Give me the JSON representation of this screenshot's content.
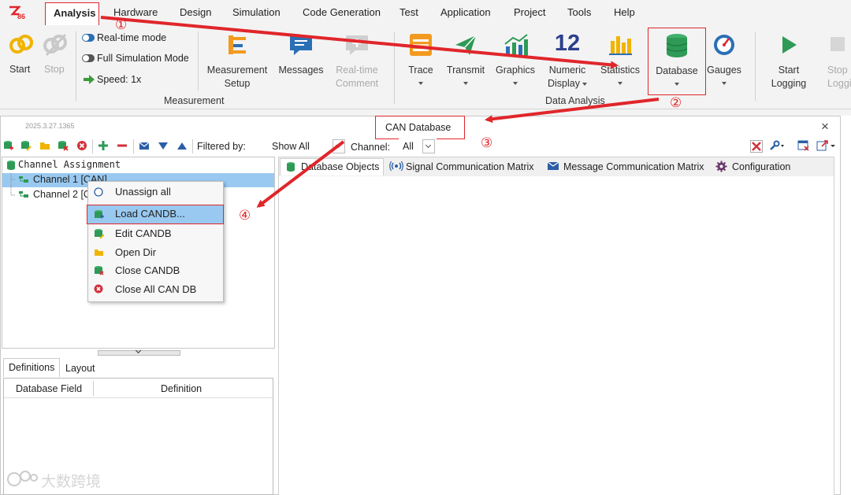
{
  "menubar": {
    "items": [
      "Analysis",
      "Hardware",
      "Design",
      "Simulation",
      "Code Generation",
      "Test",
      "Application",
      "Project",
      "Tools",
      "Help"
    ],
    "active": "Analysis"
  },
  "ribbon": {
    "start": "Start",
    "stop": "Stop",
    "realtime_mode": "Real-time mode",
    "full_sim": "Full Simulation Mode",
    "speed": "Speed: 1x",
    "meas_setup_1": "Measurement",
    "meas_setup_2": "Setup",
    "messages": "Messages",
    "rt_comment_1": "Real-time",
    "rt_comment_2": "Comment",
    "measurement_group": "Measurement",
    "trace": "Trace",
    "transmit": "Transmit",
    "graphics": "Graphics",
    "numeric_1": "Numeric",
    "numeric_2": "Display",
    "numeric_icon": "12",
    "statistics": "Statistics",
    "database": "Database",
    "gauges": "Gauges",
    "data_analysis_group": "Data Analysis",
    "start_logging_1": "Start",
    "start_logging_2": "Logging",
    "stop_logging_1": "Stop",
    "stop_logging_2": "Loggin"
  },
  "panel": {
    "version": "2025.3.27.1365",
    "title": "CAN Database",
    "close": "×"
  },
  "toolbar": {
    "filtered_by_label": "Filtered by:",
    "filter_value": "Show All",
    "channel_label": "Channel:",
    "channel_value": "All"
  },
  "tree": {
    "header": "Channel Assignment",
    "channel1": "Channel 1 [CAN]",
    "channel2": "Channel 2 [C"
  },
  "context_menu": [
    {
      "label": "Unassign all",
      "icon": "circle-icon"
    },
    {
      "label": "Load CANDB...",
      "icon": "database-load-icon"
    },
    {
      "label": "Edit CANDB",
      "icon": "database-edit-icon"
    },
    {
      "label": "Open Dir",
      "icon": "folder-icon"
    },
    {
      "label": "Close CANDB",
      "icon": "database-close-icon"
    },
    {
      "label": "Close All CAN DB",
      "icon": "close-circle-icon"
    }
  ],
  "bottom_tabs": [
    "Definitions",
    "Layout"
  ],
  "bottom_table": {
    "columns": [
      "Database Field",
      "Definition"
    ]
  },
  "right_tabs": [
    "Database Objects",
    "Signal Communication Matrix",
    "Message Communication Matrix",
    "Configuration"
  ],
  "annotations": [
    "①",
    "②",
    "③",
    "④"
  ],
  "watermark": "大数跨境",
  "colors": {
    "accent_red": "#e0262b",
    "db_green": "#2e9a56",
    "select_blue": "#99c9f0"
  }
}
